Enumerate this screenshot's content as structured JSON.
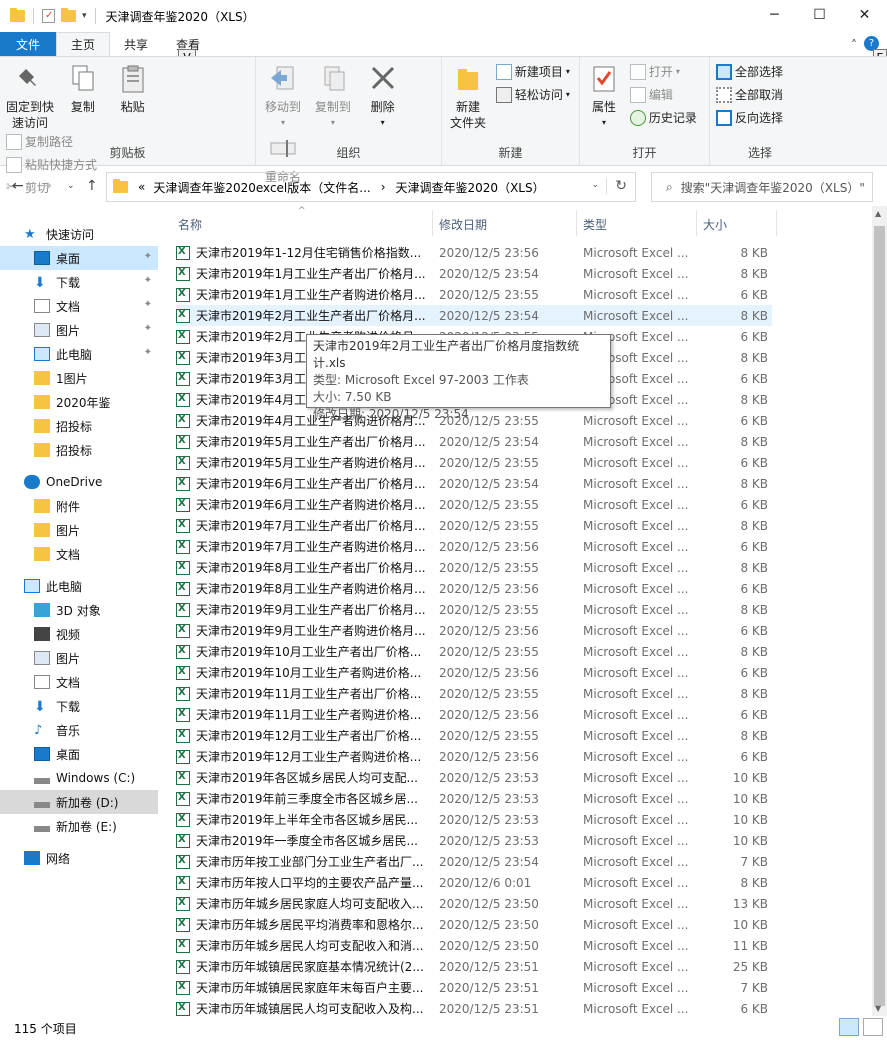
{
  "window": {
    "title": "天津调查年鉴2020（XLS）",
    "minimize": "─",
    "maximize": "☐",
    "close": "✕"
  },
  "tabs": {
    "file": "文件",
    "home": "主页",
    "share": "共享",
    "view": "查看"
  },
  "keytips": {
    "view": "V",
    "help": "E"
  },
  "ribbon": {
    "clipboard": {
      "label": "剪贴板",
      "pin": "固定到快\n速访问",
      "copy": "复制",
      "paste": "粘贴",
      "copy_path": "复制路径",
      "paste_shortcut": "粘贴快捷方式",
      "cut": "剪切"
    },
    "organize": {
      "label": "组织",
      "move_to": "移动到",
      "copy_to": "复制到",
      "delete": "删除",
      "rename": "重命名"
    },
    "new": {
      "label": "新建",
      "new_folder": "新建\n文件夹",
      "new_item": "新建项目",
      "easy_access": "轻松访问"
    },
    "open": {
      "label": "打开",
      "properties": "属性",
      "open": "打开",
      "edit": "编辑",
      "history": "历史记录"
    },
    "select": {
      "label": "选择",
      "select_all": "全部选择",
      "select_none": "全部取消",
      "invert": "反向选择"
    }
  },
  "address": {
    "prefix": "«",
    "crumb1": "天津调查年鉴2020excel版本（文件名...",
    "arrow": "›",
    "crumb2": "天津调查年鉴2020（XLS）",
    "search_placeholder": "搜索\"天津调查年鉴2020（XLS）\""
  },
  "nav": [
    {
      "label": "快速访问",
      "icon": "star-icon",
      "level": 0
    },
    {
      "label": "桌面",
      "icon": "desktop-icon",
      "level": 1,
      "pinned": true,
      "sel": true
    },
    {
      "label": "下载",
      "icon": "download-icon",
      "level": 1,
      "pinned": true
    },
    {
      "label": "文档",
      "icon": "document-icon",
      "level": 1,
      "pinned": true
    },
    {
      "label": "图片",
      "icon": "pictures-icon",
      "level": 1,
      "pinned": true
    },
    {
      "label": "此电脑",
      "icon": "computer-icon",
      "level": 1,
      "pinned": true
    },
    {
      "label": "1图片",
      "icon": "folder-icon",
      "level": 1
    },
    {
      "label": "2020年鉴",
      "icon": "folder-icon",
      "level": 1
    },
    {
      "label": "招投标",
      "icon": "folder-icon",
      "level": 1
    },
    {
      "label": "招投标",
      "icon": "folder-icon",
      "level": 1
    },
    {
      "label": "",
      "icon": "",
      "level": -1
    },
    {
      "label": "OneDrive",
      "icon": "cloud-icon",
      "level": 0
    },
    {
      "label": "附件",
      "icon": "folder-icon",
      "level": 1
    },
    {
      "label": "图片",
      "icon": "folder-icon",
      "level": 1
    },
    {
      "label": "文档",
      "icon": "folder-icon",
      "level": 1
    },
    {
      "label": "",
      "icon": "",
      "level": -1
    },
    {
      "label": "此电脑",
      "icon": "computer-icon",
      "level": 0
    },
    {
      "label": "3D 对象",
      "icon": "3d-objects-icon",
      "level": 1
    },
    {
      "label": "视频",
      "icon": "video-icon",
      "level": 1
    },
    {
      "label": "图片",
      "icon": "pictures-icon",
      "level": 1
    },
    {
      "label": "文档",
      "icon": "document-icon",
      "level": 1
    },
    {
      "label": "下载",
      "icon": "download-icon",
      "level": 1
    },
    {
      "label": "音乐",
      "icon": "music-icon",
      "level": 1
    },
    {
      "label": "桌面",
      "icon": "desktop-icon",
      "level": 1
    },
    {
      "label": "Windows (C:)",
      "icon": "drive-icon",
      "level": 1
    },
    {
      "label": "新加卷 (D:)",
      "icon": "drive-icon",
      "level": 1,
      "sel2": true
    },
    {
      "label": "新加卷 (E:)",
      "icon": "drive-icon",
      "level": 1
    },
    {
      "label": "",
      "icon": "",
      "level": -1
    },
    {
      "label": "网络",
      "icon": "network-icon",
      "level": 0
    }
  ],
  "columns": {
    "name": "名称",
    "date": "修改日期",
    "type": "类型",
    "size": "大小"
  },
  "files": [
    {
      "name": "天津市2019年1-12月住宅销售价格指数...",
      "date": "2020/12/5 23:56",
      "type": "Microsoft Excel ...",
      "size": "8 KB"
    },
    {
      "name": "天津市2019年1月工业生产者出厂价格月...",
      "date": "2020/12/5 23:54",
      "type": "Microsoft Excel ...",
      "size": "8 KB"
    },
    {
      "name": "天津市2019年1月工业生产者购进价格月...",
      "date": "2020/12/5 23:55",
      "type": "Microsoft Excel ...",
      "size": "6 KB"
    },
    {
      "name": "天津市2019年2月工业生产者出厂价格月...",
      "date": "2020/12/5 23:54",
      "type": "Microsoft Excel ...",
      "size": "8 KB"
    },
    {
      "name": "天津市2019年2月工业生产者购进价格月...",
      "date": "2020/12/5 23:55",
      "type": "Microsoft Excel ...",
      "size": "6 KB"
    },
    {
      "name": "天津市2019年3月工业生产者出厂价格月...",
      "date": "2020/12/5 23:54",
      "type": "Microsoft Excel ...",
      "size": "8 KB"
    },
    {
      "name": "天津市2019年3月工业生产者购进价格月...",
      "date": "2020/12/5 23:55",
      "type": "Microsoft Excel ...",
      "size": "6 KB"
    },
    {
      "name": "天津市2019年4月工业生产者出厂价格月...",
      "date": "2020/12/5 23:54",
      "type": "Microsoft Excel ...",
      "size": "8 KB"
    },
    {
      "name": "天津市2019年4月工业生产者购进价格月...",
      "date": "2020/12/5 23:55",
      "type": "Microsoft Excel ...",
      "size": "6 KB"
    },
    {
      "name": "天津市2019年5月工业生产者出厂价格月...",
      "date": "2020/12/5 23:54",
      "type": "Microsoft Excel ...",
      "size": "8 KB"
    },
    {
      "name": "天津市2019年5月工业生产者购进价格月...",
      "date": "2020/12/5 23:55",
      "type": "Microsoft Excel ...",
      "size": "6 KB"
    },
    {
      "name": "天津市2019年6月工业生产者出厂价格月...",
      "date": "2020/12/5 23:54",
      "type": "Microsoft Excel ...",
      "size": "8 KB"
    },
    {
      "name": "天津市2019年6月工业生产者购进价格月...",
      "date": "2020/12/5 23:55",
      "type": "Microsoft Excel ...",
      "size": "6 KB"
    },
    {
      "name": "天津市2019年7月工业生产者出厂价格月...",
      "date": "2020/12/5 23:55",
      "type": "Microsoft Excel ...",
      "size": "8 KB"
    },
    {
      "name": "天津市2019年7月工业生产者购进价格月...",
      "date": "2020/12/5 23:56",
      "type": "Microsoft Excel ...",
      "size": "6 KB"
    },
    {
      "name": "天津市2019年8月工业生产者出厂价格月...",
      "date": "2020/12/5 23:55",
      "type": "Microsoft Excel ...",
      "size": "8 KB"
    },
    {
      "name": "天津市2019年8月工业生产者购进价格月...",
      "date": "2020/12/5 23:56",
      "type": "Microsoft Excel ...",
      "size": "6 KB"
    },
    {
      "name": "天津市2019年9月工业生产者出厂价格月...",
      "date": "2020/12/5 23:55",
      "type": "Microsoft Excel ...",
      "size": "8 KB"
    },
    {
      "name": "天津市2019年9月工业生产者购进价格月...",
      "date": "2020/12/5 23:56",
      "type": "Microsoft Excel ...",
      "size": "6 KB"
    },
    {
      "name": "天津市2019年10月工业生产者出厂价格...",
      "date": "2020/12/5 23:55",
      "type": "Microsoft Excel ...",
      "size": "8 KB"
    },
    {
      "name": "天津市2019年10月工业生产者购进价格...",
      "date": "2020/12/5 23:56",
      "type": "Microsoft Excel ...",
      "size": "6 KB"
    },
    {
      "name": "天津市2019年11月工业生产者出厂价格...",
      "date": "2020/12/5 23:55",
      "type": "Microsoft Excel ...",
      "size": "8 KB"
    },
    {
      "name": "天津市2019年11月工业生产者购进价格...",
      "date": "2020/12/5 23:56",
      "type": "Microsoft Excel ...",
      "size": "6 KB"
    },
    {
      "name": "天津市2019年12月工业生产者出厂价格...",
      "date": "2020/12/5 23:55",
      "type": "Microsoft Excel ...",
      "size": "8 KB"
    },
    {
      "name": "天津市2019年12月工业生产者购进价格...",
      "date": "2020/12/5 23:56",
      "type": "Microsoft Excel ...",
      "size": "6 KB"
    },
    {
      "name": "天津市2019年各区城乡居民人均可支配...",
      "date": "2020/12/5 23:53",
      "type": "Microsoft Excel ...",
      "size": "10 KB"
    },
    {
      "name": "天津市2019年前三季度全市各区城乡居...",
      "date": "2020/12/5 23:53",
      "type": "Microsoft Excel ...",
      "size": "10 KB"
    },
    {
      "name": "天津市2019年上半年全市各区城乡居民...",
      "date": "2020/12/5 23:53",
      "type": "Microsoft Excel ...",
      "size": "10 KB"
    },
    {
      "name": "天津市2019年一季度全市各区城乡居民...",
      "date": "2020/12/5 23:53",
      "type": "Microsoft Excel ...",
      "size": "10 KB"
    },
    {
      "name": "天津市历年按工业部门分工业生产者出厂...",
      "date": "2020/12/5 23:54",
      "type": "Microsoft Excel ...",
      "size": "7 KB"
    },
    {
      "name": "天津市历年按人口平均的主要农产品产量...",
      "date": "2020/12/6 0:01",
      "type": "Microsoft Excel ...",
      "size": "8 KB"
    },
    {
      "name": "天津市历年城乡居民家庭人均可支配收入...",
      "date": "2020/12/5 23:50",
      "type": "Microsoft Excel ...",
      "size": "13 KB"
    },
    {
      "name": "天津市历年城乡居民平均消费率和恩格尔...",
      "date": "2020/12/5 23:50",
      "type": "Microsoft Excel ...",
      "size": "10 KB"
    },
    {
      "name": "天津市历年城乡居民人均可支配收入和消...",
      "date": "2020/12/5 23:50",
      "type": "Microsoft Excel ...",
      "size": "11 KB"
    },
    {
      "name": "天津市历年城镇居民家庭基本情况统计(2...",
      "date": "2020/12/5 23:51",
      "type": "Microsoft Excel ...",
      "size": "25 KB"
    },
    {
      "name": "天津市历年城镇居民家庭年末每百户主要...",
      "date": "2020/12/5 23:51",
      "type": "Microsoft Excel ...",
      "size": "7 KB"
    },
    {
      "name": "天津市历年城镇居民人均可支配收入及构...",
      "date": "2020/12/5 23:51",
      "type": "Microsoft Excel ...",
      "size": "6 KB"
    }
  ],
  "tooltip": {
    "line1": "天津市2019年2月工业生产者出厂价格月度指数统计.xls",
    "line2": "类型: Microsoft Excel 97-2003 工作表",
    "line3": "大小: 7.50 KB",
    "line4": "修改日期: 2020/12/5 23:54"
  },
  "status": {
    "count": "115 个项目"
  },
  "colors": {
    "file_tab": "#1979ca",
    "hover_row": "#e5f3ff",
    "folder": "#f6c343"
  }
}
